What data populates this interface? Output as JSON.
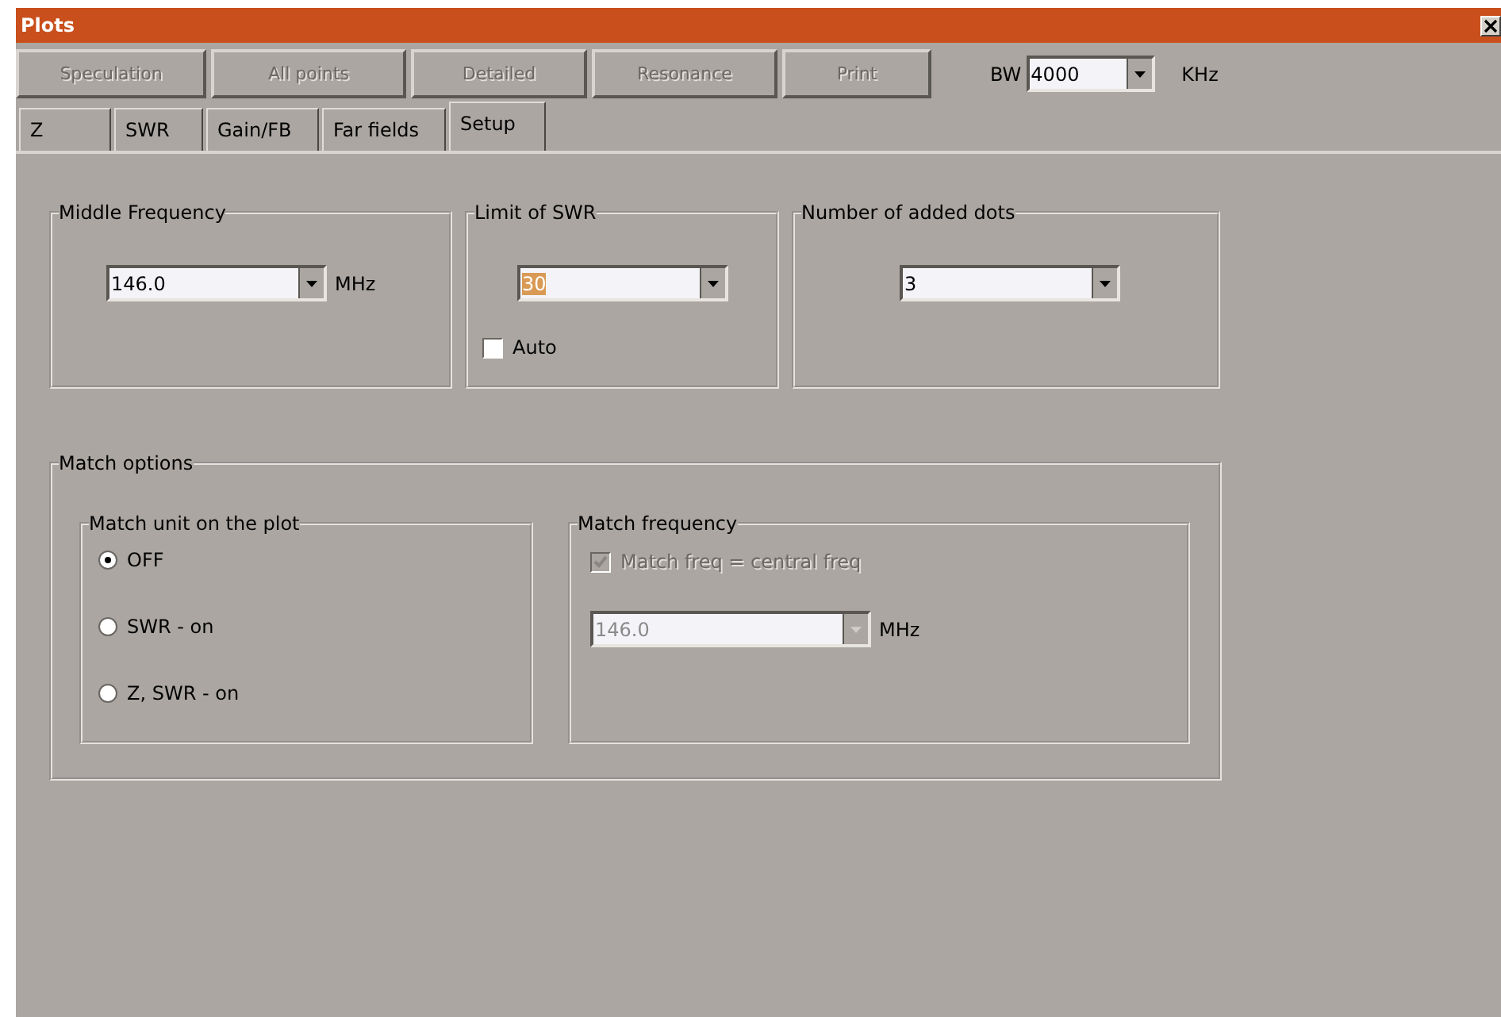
{
  "window": {
    "title": "Plots"
  },
  "toolbar": {
    "buttons": [
      {
        "label": "Speculation",
        "disabled": true
      },
      {
        "label": "All points",
        "disabled": true
      },
      {
        "label": "Detailed",
        "disabled": true
      },
      {
        "label": "Resonance",
        "disabled": true
      },
      {
        "label": "Print",
        "disabled": true
      }
    ],
    "bw": {
      "label": "BW",
      "value": "4000",
      "unit": "KHz"
    }
  },
  "tabs": [
    {
      "label": "Z",
      "selected": false
    },
    {
      "label": "SWR",
      "selected": false
    },
    {
      "label": "Gain/FB",
      "selected": false
    },
    {
      "label": "Far fields",
      "selected": false
    },
    {
      "label": "Setup",
      "selected": true
    }
  ],
  "setup": {
    "middle_frequency": {
      "title": "Middle Frequency",
      "value": "146.0",
      "unit": "MHz"
    },
    "limit_of_swr": {
      "title": "Limit of SWR",
      "value": "30",
      "text_selected": true,
      "auto": {
        "label": "Auto",
        "checked": false
      }
    },
    "added_dots": {
      "title": "Number of added dots",
      "value": "3"
    },
    "match_options": {
      "title": "Match options",
      "match_unit": {
        "title": "Match unit on the plot",
        "options": [
          {
            "label": "OFF",
            "selected": true
          },
          {
            "label": "SWR - on",
            "selected": false
          },
          {
            "label": "Z, SWR - on",
            "selected": false
          }
        ]
      },
      "match_frequency": {
        "title": "Match frequency",
        "equal_central": {
          "label": "Match freq = central freq",
          "checked": true,
          "disabled": true
        },
        "value": "146.0",
        "unit": "MHz",
        "disabled": true
      }
    }
  }
}
